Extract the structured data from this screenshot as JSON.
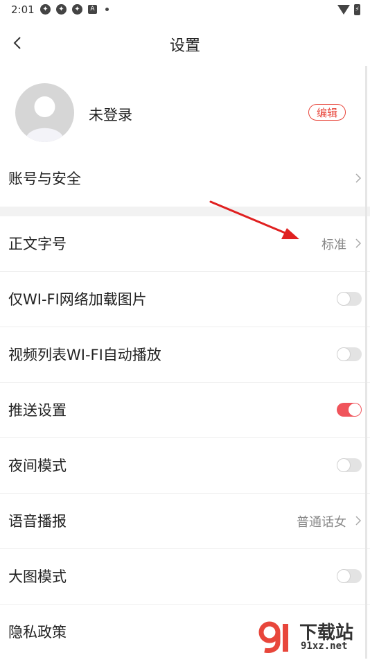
{
  "status_bar": {
    "time": "2:01",
    "notif_icons": [
      "app-icon",
      "app-icon",
      "app-icon",
      "a-icon"
    ],
    "right_icons": [
      "wifi-icon",
      "battery-icon"
    ]
  },
  "nav": {
    "title": "设置"
  },
  "profile": {
    "name": "未登录",
    "edit_label": "编辑"
  },
  "rows": [
    {
      "label": "账号与安全"
    },
    {
      "label": "正文字号",
      "value": "标准"
    },
    {
      "label": "仅WI-FI网络加载图片",
      "toggle": false
    },
    {
      "label": "视频列表WI-FI自动播放",
      "toggle": false
    },
    {
      "label": "推送设置",
      "toggle": true
    },
    {
      "label": "夜间模式",
      "toggle": false
    },
    {
      "label": "语音播报",
      "value": "普通话女"
    },
    {
      "label": "大图模式",
      "toggle": false
    },
    {
      "label": "隐私政策"
    }
  ],
  "watermark": {
    "title": "下载站",
    "url": "91xz.net"
  },
  "colors": {
    "accent": "#e8463b",
    "toggle_on": "#f0545b",
    "annotation": "#e02020"
  }
}
